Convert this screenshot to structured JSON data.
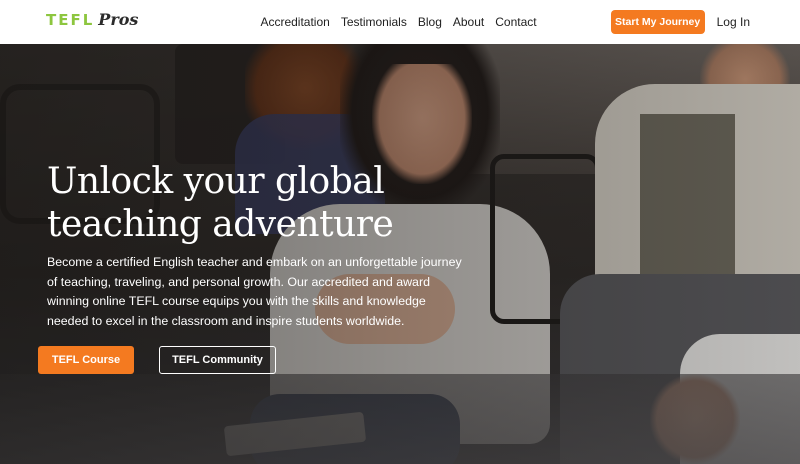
{
  "header": {
    "logo_main": "TEFL",
    "logo_script": "Pros",
    "nav": [
      "Accreditation",
      "Testimonials",
      "Blog",
      "About",
      "Contact"
    ],
    "cta_label": "Start My Journey",
    "login_label": "Log In"
  },
  "hero": {
    "title_line1": "Unlock your global",
    "title_line2": "teaching adventure",
    "description": "Become a certified English teacher and embark on an unforgettable journey of teaching, traveling, and personal growth. Our accredited and award winning online TEFL course equips you with the skills and knowledge needed to excel in the classroom and inspire students worldwide.",
    "primary_button": "TEFL Course",
    "secondary_button": "TEFL Community"
  },
  "colors": {
    "accent": "#f47a20",
    "logo_green": "#8dc63f",
    "header_bg": "#ffffff"
  }
}
